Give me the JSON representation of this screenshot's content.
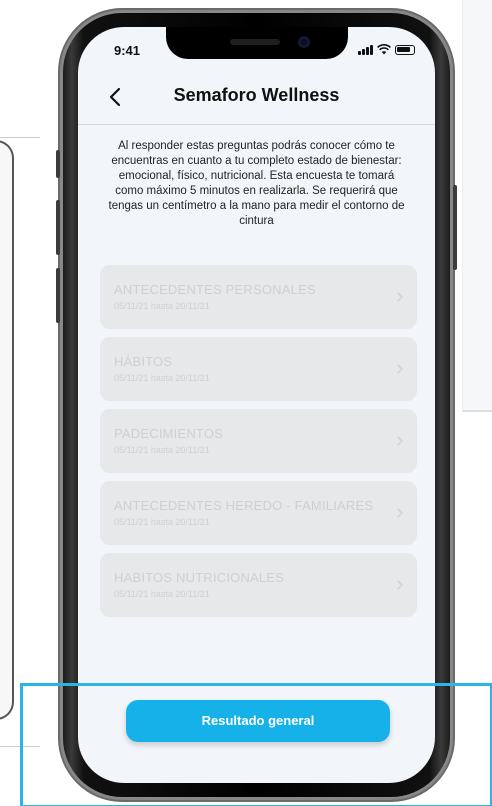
{
  "status_bar": {
    "time": "9:41"
  },
  "header": {
    "title": "Semaforo Wellness"
  },
  "intro": {
    "text": "Al responder estas preguntas podrás conocer cómo te encuentras en cuanto a tu completo estado de bienestar: emocional, físico, nutricional. Esta encuesta te tomará como máximo 5 minutos en realizarla. Se requerirá que tengas un centímetro a la mano para medir el contorno de cintura"
  },
  "items": [
    {
      "title": "ANTECEDENTES PERSONALES",
      "date": "05/11/21 hasta 20/11/21"
    },
    {
      "title": "HÁBITOS",
      "date": "05/11/21 hasta 20/11/21"
    },
    {
      "title": "PADECIMIENTOS",
      "date": "05/11/21 hasta 20/11/21"
    },
    {
      "title": "ANTECEDENTES HEREDO - FAMILIARES",
      "date": "05/11/21 hasta 20/11/21"
    },
    {
      "title": "HABITOS NUTRICIONALES",
      "date": "05/11/21 hasta 20/11/21"
    }
  ],
  "footer": {
    "button_label": "Resultado general"
  },
  "colors": {
    "accent": "#17b1e9",
    "highlight": "#2bb4e8",
    "item_bg": "#e7e8ea",
    "item_text": "#cfd0d2"
  },
  "icons": [
    "back-chevron-icon",
    "chevron-right-icon",
    "signal-icon",
    "wifi-icon",
    "battery-icon"
  ]
}
